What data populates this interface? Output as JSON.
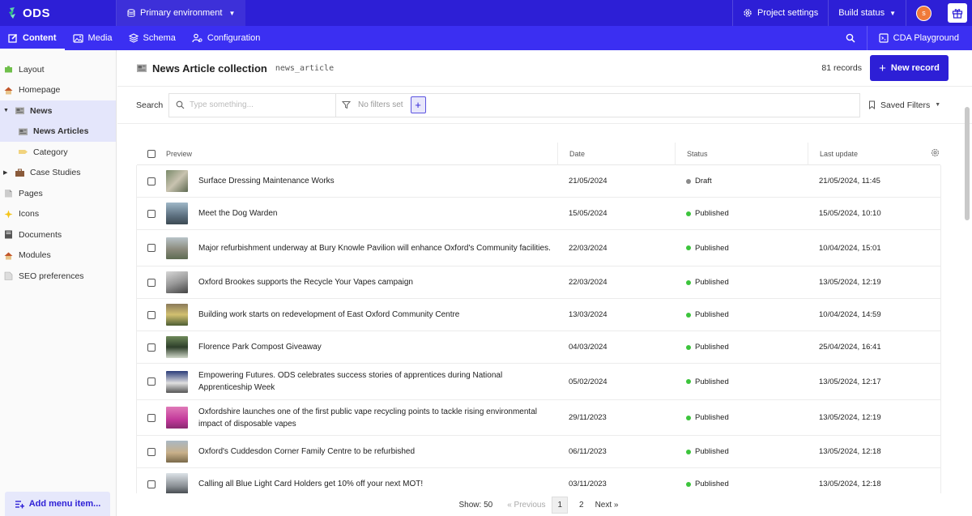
{
  "topbar": {
    "logo": "ODS",
    "environment": "Primary environment",
    "project_settings": "Project settings",
    "build_status": "Build status",
    "avatar_initial": "s"
  },
  "nav": {
    "tabs": [
      {
        "label": "Content",
        "icon": "pencil-square-icon"
      },
      {
        "label": "Media",
        "icon": "image-icon"
      },
      {
        "label": "Schema",
        "icon": "layers-icon"
      },
      {
        "label": "Configuration",
        "icon": "users-gear-icon"
      }
    ],
    "active_tab": "Content",
    "cda_playground": "CDA Playground"
  },
  "sidebar": {
    "items": [
      {
        "label": "Layout"
      },
      {
        "label": "Homepage"
      },
      {
        "label": "News"
      },
      {
        "label": "News Articles"
      },
      {
        "label": "Category"
      },
      {
        "label": "Case Studies"
      },
      {
        "label": "Pages"
      },
      {
        "label": "Icons"
      },
      {
        "label": "Documents"
      },
      {
        "label": "Modules"
      },
      {
        "label": "SEO preferences"
      }
    ],
    "add_menu_item": "Add menu item..."
  },
  "collection": {
    "title": "News Article collection",
    "api_key": "news_article",
    "record_count": "81 records",
    "new_record_label": "New record"
  },
  "filters": {
    "search_label": "Search",
    "search_placeholder": "Type something...",
    "no_filters": "No filters set",
    "saved_filters": "Saved Filters"
  },
  "table": {
    "headers": {
      "preview": "Preview",
      "date": "Date",
      "status": "Status",
      "last_update": "Last update"
    },
    "rows": [
      {
        "title": "Surface Dressing Maintenance Works",
        "date": "21/05/2024",
        "status": "Draft",
        "updated": "21/05/2024, 11:45"
      },
      {
        "title": "Meet the Dog Warden",
        "date": "15/05/2024",
        "status": "Published",
        "updated": "15/05/2024, 10:10"
      },
      {
        "title": "Major refurbishment underway at Bury Knowle Pavilion will enhance Oxford's Community facilities.",
        "date": "22/03/2024",
        "status": "Published",
        "updated": "10/04/2024, 15:01"
      },
      {
        "title": "Oxford Brookes supports the Recycle Your Vapes campaign",
        "date": "22/03/2024",
        "status": "Published",
        "updated": "13/05/2024, 12:19"
      },
      {
        "title": "Building work starts on redevelopment of East Oxford Community Centre",
        "date": "13/03/2024",
        "status": "Published",
        "updated": "10/04/2024, 14:59"
      },
      {
        "title": "Florence Park Compost Giveaway",
        "date": "04/03/2024",
        "status": "Published",
        "updated": "25/04/2024, 16:41"
      },
      {
        "title": "Empowering Futures. ODS celebrates success stories of apprentices during National Apprenticeship Week",
        "date": "05/02/2024",
        "status": "Published",
        "updated": "13/05/2024, 12:17"
      },
      {
        "title": "Oxfordshire launches one of the first public vape recycling points to tackle rising environmental impact of disposable vapes",
        "date": "29/11/2023",
        "status": "Published",
        "updated": "13/05/2024, 12:19"
      },
      {
        "title": "Oxford's Cuddesdon Corner Family Centre to be refurbished",
        "date": "06/11/2023",
        "status": "Published",
        "updated": "13/05/2024, 12:18"
      },
      {
        "title": "Calling all Blue Light Card Holders get 10% off your next MOT!",
        "date": "03/11/2023",
        "status": "Published",
        "updated": "13/05/2024, 12:18"
      }
    ]
  },
  "pagination": {
    "show": "Show: 50",
    "previous": "« Previous",
    "pages": [
      "1",
      "2"
    ],
    "current_page": "1",
    "next": "Next »"
  },
  "colors": {
    "topbar": "#2d1fd6",
    "navbar": "#3b2ff2",
    "published": "#3cc43c",
    "draft": "#8a8a8a"
  }
}
